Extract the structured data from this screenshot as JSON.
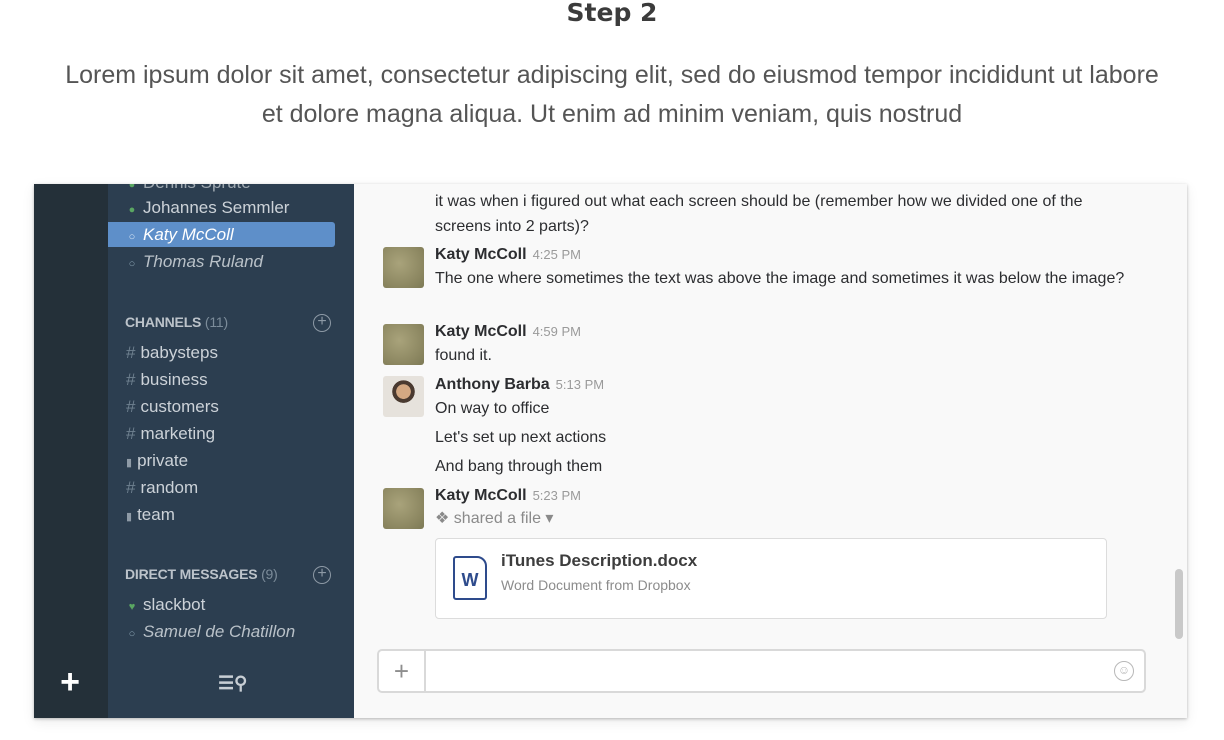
{
  "page": {
    "title": "Step 2",
    "description": "Lorem ipsum dolor sit amet, consectetur adipiscing elit, sed do eiusmod tempor incididunt ut labore et dolore magna aliqua. Ut enim ad minim veniam, quis nostrud"
  },
  "sidebar": {
    "members_top": [
      {
        "name": "Dennis Sprute",
        "status": "online"
      },
      {
        "name": "Johannes Semmler",
        "status": "online"
      },
      {
        "name": "Katy McColl",
        "status": "active"
      },
      {
        "name": "Thomas Ruland",
        "status": "away"
      }
    ],
    "channels_label": "CHANNELS",
    "channels_count": "(11)",
    "channels": [
      {
        "name": "babysteps",
        "icon": "#"
      },
      {
        "name": "business",
        "icon": "#"
      },
      {
        "name": "customers",
        "icon": "#"
      },
      {
        "name": "marketing",
        "icon": "#"
      },
      {
        "name": "private",
        "icon": "lock"
      },
      {
        "name": "random",
        "icon": "#"
      },
      {
        "name": "team",
        "icon": "lock"
      }
    ],
    "dm_label": "DIRECT MESSAGES",
    "dm_count": "(9)",
    "direct_messages": [
      {
        "name": "slackbot",
        "status": "heart"
      },
      {
        "name": "Samuel de Chatillon",
        "status": "away"
      }
    ]
  },
  "messages": {
    "continuation": "it was when i figured out what each screen should be (remember how we divided one of the screens into 2 parts)?",
    "items": [
      {
        "sender": "Katy McColl",
        "time": "4:25 PM",
        "lines": [
          "The one where sometimes the text was above the image and sometimes it was below the image?"
        ]
      },
      {
        "sender": "Katy McColl",
        "time": "4:59 PM",
        "lines": [
          "found it."
        ]
      },
      {
        "sender": "Anthony Barba",
        "time": "5:13 PM",
        "lines": [
          "On way to office",
          "Let's set up next actions",
          "And bang through them"
        ]
      },
      {
        "sender": "Katy McColl",
        "time": "5:23 PM",
        "lines": []
      }
    ],
    "shared_text": "shared a file",
    "file": {
      "name": "iTunes Description.docx",
      "subtitle": "Word Document from Dropbox",
      "icon_letter": "W"
    }
  },
  "composer": {
    "placeholder": "",
    "add_label": "+"
  },
  "colors": {
    "team_rail": "#243039",
    "sidebar": "#2c3e50",
    "active_item": "#5e8fc9",
    "file_icon": "#2e4b8c"
  }
}
